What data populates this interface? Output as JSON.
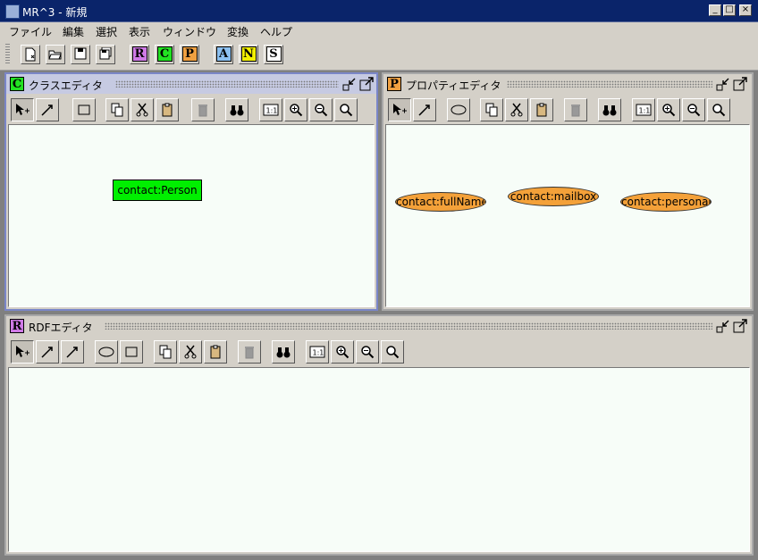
{
  "window": {
    "title": "MR^3 - 新規"
  },
  "menu": [
    "ファイル",
    "編集",
    "選択",
    "表示",
    "ウィンドウ",
    "変換",
    "ヘルプ"
  ],
  "toolbar": {
    "letters": [
      {
        "label": "R",
        "color": "#cf7ae6"
      },
      {
        "label": "C",
        "color": "#22e222"
      },
      {
        "label": "P",
        "color": "#f0a040"
      },
      {
        "label": "A",
        "color": "#8cc0f0"
      },
      {
        "label": "N",
        "color": "#f2f000"
      },
      {
        "label": "S",
        "color": "#ffffff"
      }
    ]
  },
  "class_editor": {
    "title": "クラスエディタ",
    "icon": "C",
    "icon_color": "#22e222",
    "nodes": [
      {
        "label": "contact:Person"
      }
    ]
  },
  "property_editor": {
    "title": "プロパティエディタ",
    "icon": "P",
    "icon_color": "#f0a040",
    "nodes": [
      {
        "label": "contact:fullName"
      },
      {
        "label": "contact:mailbox"
      },
      {
        "label": "contact:personal..."
      }
    ]
  },
  "rdf_editor": {
    "title": "RDFエディタ",
    "icon": "R",
    "icon_color": "#cf7ae6"
  },
  "colors": {
    "titlebar": "#0a246a",
    "active_frame": "#7a86c8",
    "class_node": "#00ef00",
    "property_node": "#f4a139",
    "canvas": "#f7fdf8"
  }
}
